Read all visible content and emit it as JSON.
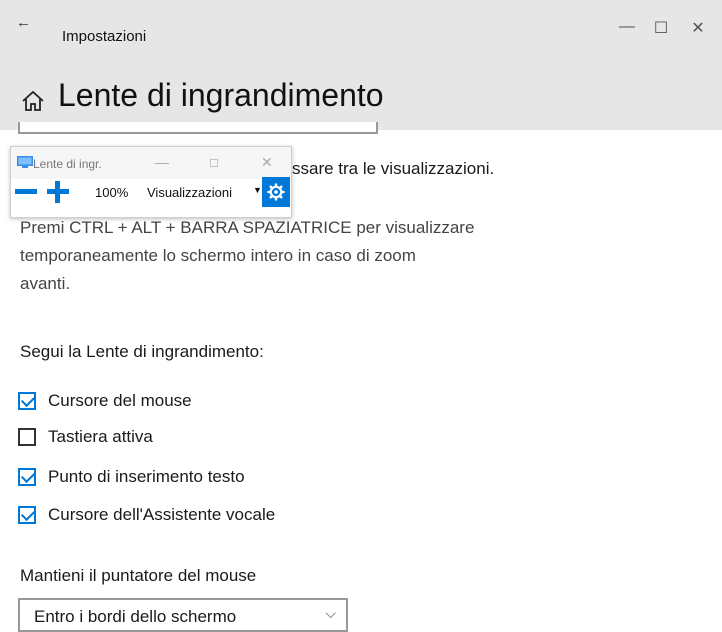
{
  "window": {
    "back_glyph": "←",
    "app_title": "Impostazioni",
    "min_glyph": "—",
    "max_glyph": "☐",
    "close_glyph": "✕",
    "page_title": "Lente di ingrandimento",
    "icon": "home-icon"
  },
  "magnifier_window": {
    "title": "Lente di ingr.",
    "min_glyph": "—",
    "max_glyph": "☐",
    "close_glyph": "✕",
    "zoom_level": "100%",
    "views_label": "Visualizzazioni",
    "views_caret": "▼",
    "settings_icon": "gear-icon",
    "accent": "#0078d7"
  },
  "content": {
    "partial_text": "ssare tra le visualizzazioni.",
    "description_lines": [
      "Premi CTRL + ALT + BARRA SPAZIATRICE per visualizzare",
      "temporaneamente lo schermo intero in caso di zoom",
      "avanti."
    ],
    "follow_label": "Segui la Lente di ingrandimento:",
    "checkboxes": [
      {
        "label": "Cursore del mouse",
        "checked": true
      },
      {
        "label": "Tastiera attiva",
        "checked": false
      },
      {
        "label": "Punto di inserimento testo",
        "checked": true
      },
      {
        "label": "Cursore dell'Assistente vocale",
        "checked": true
      }
    ],
    "keep_pointer_label": "Mantieni il puntatore del mouse",
    "keep_pointer_select": {
      "value": "Entro i bordi dello schermo",
      "caret": "⌵"
    }
  },
  "colors": {
    "accent": "#0078d7",
    "titlebar_bg": "#e6e6e6"
  }
}
